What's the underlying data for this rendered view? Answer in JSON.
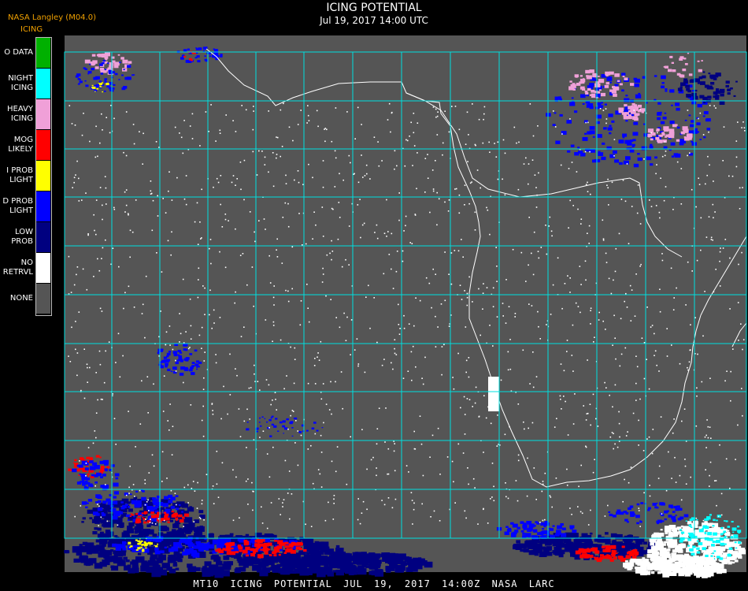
{
  "header": {
    "organization": "NASA Langley (M04.0)",
    "product": "ICING",
    "title": "ICING POTENTIAL",
    "subtitle": "Jul 19, 2017 14:00 UTC"
  },
  "legend": {
    "items": [
      {
        "label": "O DATA",
        "color": "#00b000"
      },
      {
        "label": "NIGHT\nICING",
        "color": "#00ffff"
      },
      {
        "label": "HEAVY\nICING",
        "color": "#f0a0d8"
      },
      {
        "label": "MOG\nLIKELY",
        "color": "#ff0000"
      },
      {
        "label": "I PROB\nLIGHT",
        "color": "#ffff00"
      },
      {
        "label": "D PROB\nLIGHT",
        "color": "#0000ff"
      },
      {
        "label": "LOW\nPROB",
        "color": "#000080"
      },
      {
        "label": "NO\nRETRVL",
        "color": "#ffffff"
      },
      {
        "label": "NONE",
        "color": "#555555"
      }
    ]
  },
  "map": {
    "background_color": "#555555",
    "grid_color": "#00e0e0",
    "coast_color": "#ffffff",
    "label_color": "#b02020"
  },
  "footer": {
    "text": "MT10  ICING POTENTIAL  JUL 19, 2017 14:00Z  NASA LARC"
  }
}
